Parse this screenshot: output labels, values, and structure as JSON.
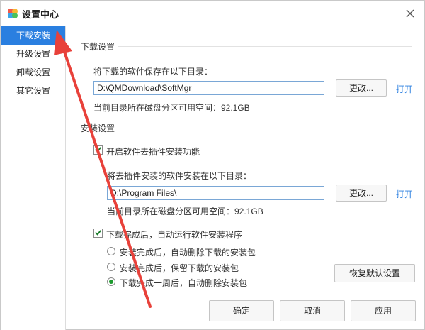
{
  "window": {
    "title": "设置中心"
  },
  "sidebar": {
    "items": [
      {
        "label": "下载安装",
        "active": true
      },
      {
        "label": "升级设置",
        "active": false
      },
      {
        "label": "卸载设置",
        "active": false
      },
      {
        "label": "其它设置",
        "active": false
      }
    ]
  },
  "download_section": {
    "title": "下载设置",
    "dir_label": "将下载的软件保存在以下目录：",
    "dir_value": "D:\\QMDownload\\SoftMgr",
    "change_label": "更改...",
    "open_label": "打开",
    "space_text": "当前目录所在磁盘分区可用空间：92.1GB"
  },
  "install_section": {
    "title": "安装设置",
    "plugin_free_checkbox": {
      "label": "开启软件去插件安装功能",
      "checked": true
    },
    "dir_label": "将去插件安装的软件安装在以下目录：",
    "dir_value": "D:\\Program Files\\",
    "change_label": "更改...",
    "open_label": "打开",
    "space_text": "当前目录所在磁盘分区可用空间：92.1GB",
    "auto_run_checkbox": {
      "label": "下载完成后，自动运行软件安装程序",
      "checked": true
    },
    "radio_options": [
      {
        "label": "安装完成后，自动删除下载的安装包",
        "selected": false
      },
      {
        "label": "安装完成后，保留下载的安装包",
        "selected": false
      },
      {
        "label": "下载完成一周后，自动删除安装包",
        "selected": true
      }
    ]
  },
  "buttons": {
    "restore_defaults": "恢复默认设置",
    "ok": "确定",
    "cancel": "取消",
    "apply": "应用"
  },
  "colors": {
    "accent": "#2a7fe0",
    "annotation_arrow": "#e8413a"
  }
}
